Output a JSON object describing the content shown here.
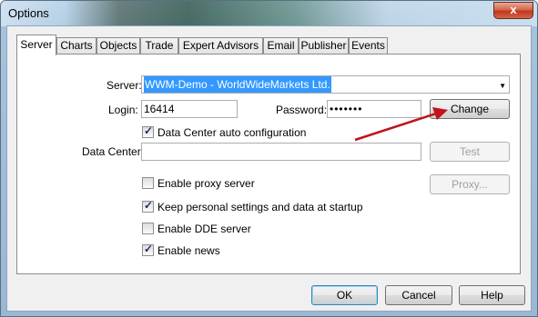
{
  "window": {
    "title": "Options",
    "close_symbol": "x"
  },
  "tabs": [
    "Server",
    "Charts",
    "Objects",
    "Trade",
    "Expert Advisors",
    "Email",
    "Publisher",
    "Events"
  ],
  "server": {
    "server_label": "Server:",
    "server_value": "WWM-Demo - WorldWideMarkets Ltd.",
    "login_label": "Login:",
    "login_value": "16414",
    "password_label": "Password:",
    "password_value": "•••••••",
    "change_button": "Change",
    "datacenter_auto_label": "Data Center auto configuration",
    "datacenter_auto_checked": true,
    "datacenter_label": "Data Center:",
    "datacenter_value": "",
    "test_button": "Test",
    "proxy_enable_label": "Enable proxy server",
    "proxy_enable_checked": false,
    "proxy_button": "Proxy...",
    "keep_settings_label": "Keep personal settings and data at startup",
    "keep_settings_checked": true,
    "dde_label": "Enable DDE server",
    "dde_checked": false,
    "news_label": "Enable news",
    "news_checked": true
  },
  "footer": {
    "ok": "OK",
    "cancel": "Cancel",
    "help": "Help"
  },
  "annotation": {
    "arrow_color": "#c0141a"
  }
}
